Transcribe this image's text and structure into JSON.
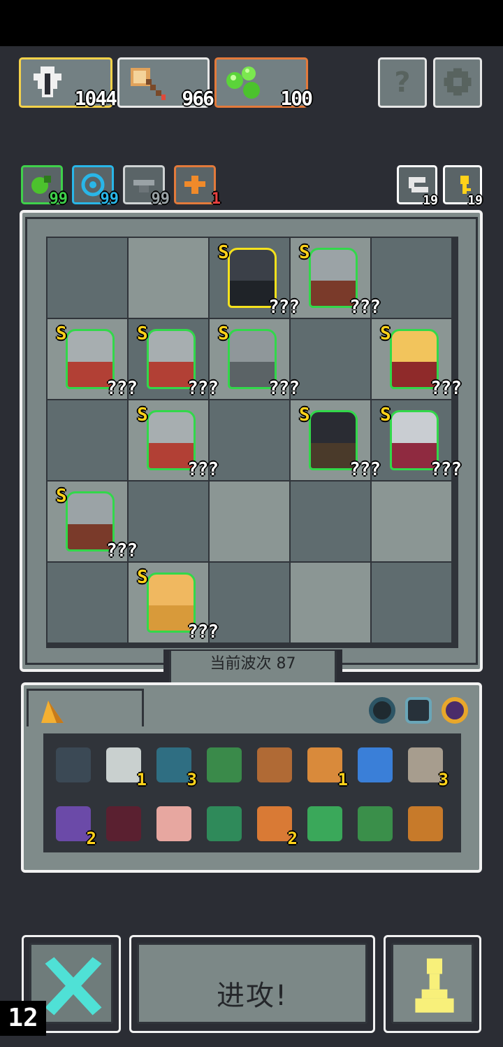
{
  "resources": [
    {
      "icon": "shield-heart-icon",
      "value": "1044",
      "color": "#f5d24a"
    },
    {
      "icon": "axe-icon",
      "value": "966",
      "color": "#e8e8e8"
    },
    {
      "icon": "green-orbs-icon",
      "value": "100",
      "color": "#e37a3b"
    }
  ],
  "top_buttons": {
    "help_label": "?",
    "settings_icon": "gear-icon"
  },
  "status_chips": [
    {
      "icon": "green-potion-icon",
      "count": "99",
      "count_color": "#3fd14b"
    },
    {
      "icon": "blue-swirl-icon",
      "count": "99",
      "count_color": "#29b6e8"
    },
    {
      "icon": "gray-bird-icon",
      "count": "99",
      "count_color": "#9aa2a6"
    },
    {
      "icon": "orange-arrow-icon",
      "count": "1",
      "count_color": "#e84040"
    }
  ],
  "right_chips": [
    {
      "icon": "refresh-icon",
      "count": "19"
    },
    {
      "icon": "yellow-key-icon",
      "count": "19"
    }
  ],
  "board": {
    "wave_label": "当前波次 87",
    "units": [
      {
        "row": 0,
        "col": 2,
        "tier": "S",
        "level": "???",
        "kind": "dark-knight",
        "border": "#f5e21c"
      },
      {
        "row": 0,
        "col": 3,
        "tier": "S",
        "level": "???",
        "kind": "shield-soldier",
        "border": "#32d84a"
      },
      {
        "row": 1,
        "col": 0,
        "tier": "S",
        "level": "???",
        "kind": "swordsman",
        "border": "#32d84a"
      },
      {
        "row": 1,
        "col": 1,
        "tier": "S",
        "level": "???",
        "kind": "swordsman",
        "border": "#32d84a"
      },
      {
        "row": 1,
        "col": 2,
        "tier": "S",
        "level": "???",
        "kind": "helmet-guard",
        "border": "#32d84a"
      },
      {
        "row": 1,
        "col": 4,
        "tier": "S",
        "level": "???",
        "kind": "blonde-fighter",
        "border": "#32d84a"
      },
      {
        "row": 2,
        "col": 1,
        "tier": "S",
        "level": "???",
        "kind": "swordsman",
        "border": "#32d84a"
      },
      {
        "row": 2,
        "col": 3,
        "tier": "S",
        "level": "???",
        "kind": "black-hat-hunter",
        "border": "#32d84a"
      },
      {
        "row": 2,
        "col": 4,
        "tier": "S",
        "level": "???",
        "kind": "silver-hair-mage",
        "border": "#32d84a"
      },
      {
        "row": 3,
        "col": 0,
        "tier": "S",
        "level": "???",
        "kind": "shield-soldier",
        "border": "#32d84a"
      },
      {
        "row": 4,
        "col": 1,
        "tier": "S",
        "level": "???",
        "kind": "golden-brawler",
        "border": "#32d84a"
      }
    ]
  },
  "inventory": {
    "tab_icon": "orange-triangle-icon",
    "filter_icons": [
      "dark-ring-icon",
      "armor-icon",
      "purple-ring-icon"
    ],
    "items": [
      {
        "icon": "crate-icon",
        "count": "",
        "color": "#3b4955"
      },
      {
        "icon": "scroll-icon",
        "count": "1",
        "color": "#c9d0cf"
      },
      {
        "icon": "heart-gem-icon",
        "count": "3",
        "color": "#2f6e82"
      },
      {
        "icon": "chest-icon",
        "count": "",
        "color": "#3a8a4a"
      },
      {
        "icon": "dagger-icon",
        "count": "",
        "color": "#b06a35"
      },
      {
        "icon": "red-box-icon",
        "count": "1",
        "color": "#d98a3b"
      },
      {
        "icon": "blue-wisp-icon",
        "count": "",
        "color": "#3a7fd8"
      },
      {
        "icon": "map-icon",
        "count": "3",
        "color": "#a79d8e"
      },
      {
        "icon": "purple-potion-icon",
        "count": "2",
        "color": "#6b4aa8"
      },
      {
        "icon": "eye-ring-icon",
        "count": "",
        "color": "#5a2030"
      },
      {
        "icon": "hand-icon",
        "count": "",
        "color": "#e7a7a0"
      },
      {
        "icon": "green-axe-icon",
        "count": "",
        "color": "#2f8a5a"
      },
      {
        "icon": "orange-axe-icon",
        "count": "2",
        "color": "#d97a35"
      },
      {
        "icon": "green-sword-icon",
        "count": "",
        "color": "#3aa85a"
      },
      {
        "icon": "green-arrow-icon",
        "count": "",
        "color": "#3a8f4a"
      },
      {
        "icon": "orange-claw-icon",
        "count": "",
        "color": "#c77a2a"
      }
    ]
  },
  "bottom": {
    "cancel_icon": "cross-icon",
    "attack_label": "进攻!",
    "pawn_icon": "pawn-icon",
    "corner_number": "12"
  }
}
